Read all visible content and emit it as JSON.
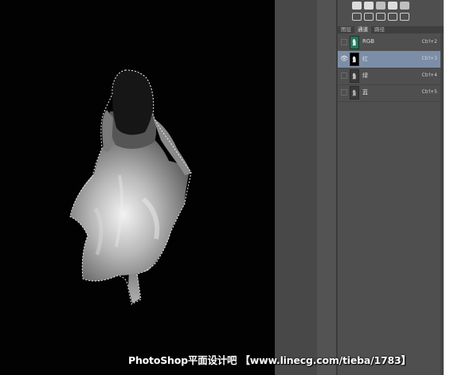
{
  "panel": {
    "tabs": [
      {
        "label": "图层",
        "active": false
      },
      {
        "label": "通道",
        "active": true
      },
      {
        "label": "路径",
        "active": false
      }
    ],
    "channels": [
      {
        "name": "RGB",
        "shortcut": "Ctrl+2",
        "visible": false,
        "selected": false,
        "thumb": "rgb"
      },
      {
        "name": "红",
        "shortcut": "Ctrl+3",
        "visible": true,
        "selected": true,
        "thumb": "red"
      },
      {
        "name": "绿",
        "shortcut": "Ctrl+4",
        "visible": false,
        "selected": false,
        "thumb": "green"
      },
      {
        "name": "蓝",
        "shortcut": "Ctrl+5",
        "visible": false,
        "selected": false,
        "thumb": "blue"
      }
    ],
    "tool_icons": [
      "path-tool-icon",
      "adjust-icon",
      "fill-icon",
      "recycle-icon",
      "grid-icon",
      "levels-icon",
      "curves-icon",
      "gradient-icon",
      "exposure-icon",
      "hue-icon"
    ]
  },
  "canvas": {
    "background_color": "#020202",
    "selection": "marching-ants"
  },
  "watermark": {
    "text": "PhotoShop平面设计吧 【www.linecg.com/tieba/1783】"
  },
  "colors": {
    "selected_row": "#7c8ea7",
    "panel_bg": "#4f4f4f",
    "pasteboard": "#484848"
  }
}
